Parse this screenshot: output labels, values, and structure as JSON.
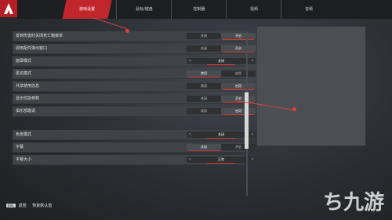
{
  "tabs": [
    {
      "label": "游戏设置",
      "active": true
    },
    {
      "label": "鼠标/键盘",
      "active": false
    },
    {
      "label": "控制器",
      "active": false
    },
    {
      "label": "视频",
      "active": false
    },
    {
      "label": "音频",
      "active": false
    }
  ],
  "settings": [
    {
      "label": "受到伤害时关闭死亡箱菜单",
      "type": "toggle",
      "opt1": "关闭",
      "opt2": "开启",
      "selected": 2
    },
    {
      "label": "即用配件弹出窗口",
      "type": "toggle",
      "opt1": "关闭",
      "opt2": "开启",
      "selected": 2
    },
    {
      "label": "面罩模式",
      "type": "select",
      "value": "关闭"
    },
    {
      "label": "匿名模式",
      "type": "toggle",
      "opt1": "禁用",
      "opt2": "启用",
      "selected": 1
    },
    {
      "label": "共享使用信息",
      "type": "toggle",
      "opt1": "禁用",
      "opt2": "启用",
      "selected": 2
    },
    {
      "label": "显示性能参数",
      "type": "toggle",
      "opt1": "关闭",
      "opt2": "开启",
      "selected": 2
    },
    {
      "label": "俱乐部邀请",
      "type": "toggle",
      "opt1": "禁用",
      "opt2": "启用",
      "selected": 2
    }
  ],
  "settings2": [
    {
      "label": "色盲模式",
      "type": "select",
      "value": "关闭"
    },
    {
      "label": "字幕",
      "type": "toggle",
      "opt1": "关闭",
      "opt2": "开启",
      "selected": 1
    },
    {
      "label": "字幕大小",
      "type": "select",
      "value": "正常"
    }
  ],
  "footer": {
    "key": "ESC",
    "back": "返回",
    "reset": "恢复默认值"
  },
  "watermark": "九游",
  "colors": {
    "accent": "#c0262b",
    "marker": "#e2403a"
  }
}
